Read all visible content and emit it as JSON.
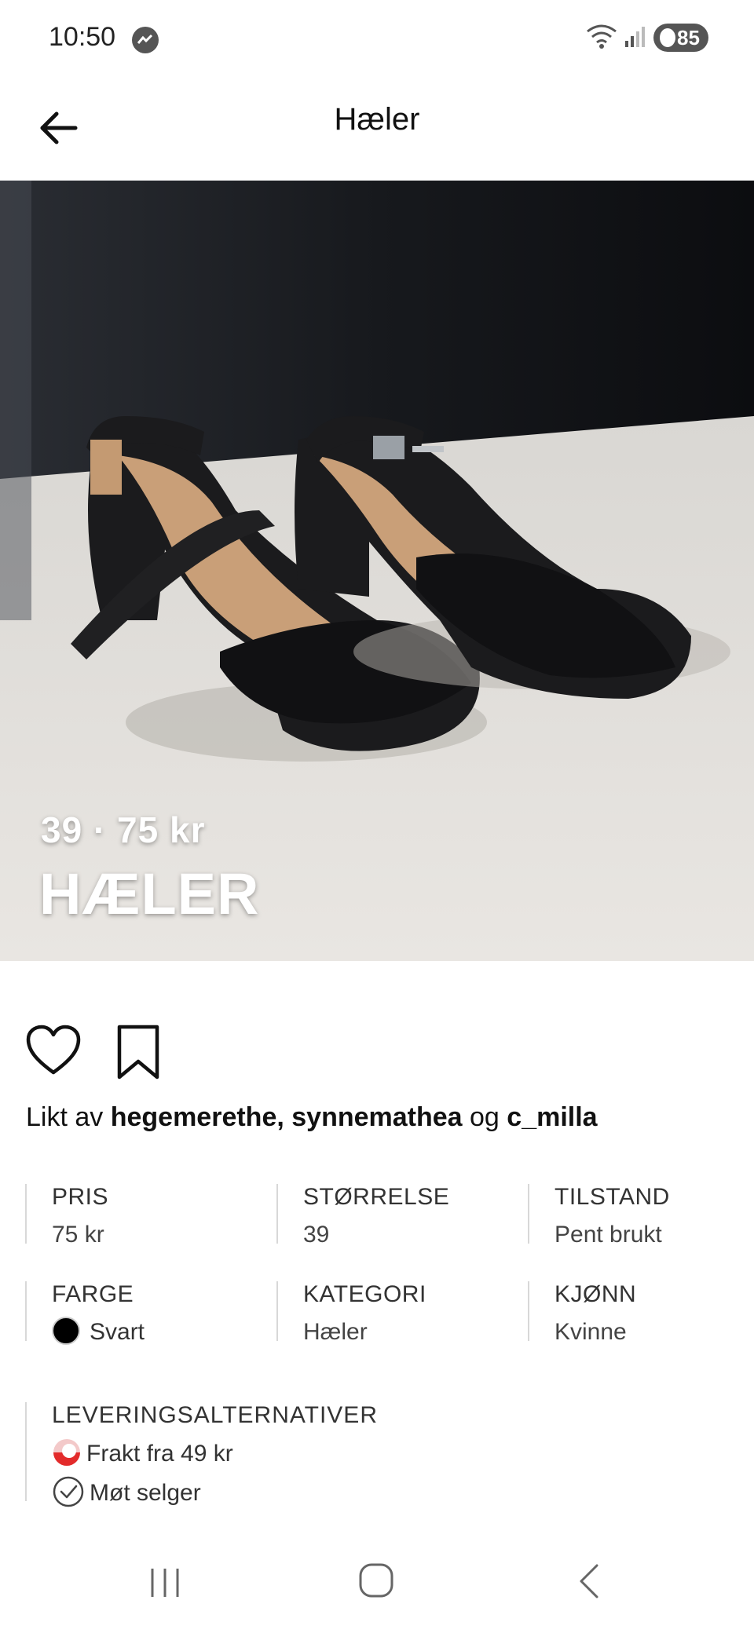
{
  "status_bar": {
    "time": "10:50",
    "battery": "85",
    "icons": [
      "messenger-icon",
      "wifi-icon",
      "signal-icon",
      "battery-icon"
    ]
  },
  "header": {
    "title": "Hæler",
    "back_icon": "arrow-left-icon"
  },
  "photo": {
    "overlay_price": "39 · 75 kr",
    "overlay_title": "HÆLER"
  },
  "actions": {
    "like_icon": "heart-icon",
    "save_icon": "bookmark-icon"
  },
  "liked_by": {
    "prefix": "Likt av",
    "users": "hegemerethe, synnemathea",
    "joiner": "og",
    "last_user": "c_milla"
  },
  "details": [
    {
      "label": "PRIS",
      "value": "75 kr"
    },
    {
      "label": "STØRRELSE",
      "value": "39"
    },
    {
      "label": "TILSTAND",
      "value": "Pent brukt"
    },
    {
      "label": "FARGE",
      "value": "Svart",
      "swatch": "#000000"
    },
    {
      "label": "KATEGORI",
      "value": "Hæler"
    },
    {
      "label": "KJØNN",
      "value": "Kvinne"
    }
  ],
  "delivery": {
    "label": "LEVERINGSALTERNATIVER",
    "options": [
      {
        "text": "Frakt fra 49 kr",
        "icon": "shipping-icon"
      },
      {
        "text": "Møt selger",
        "icon": "check-circle-icon"
      }
    ]
  },
  "nav_bar": {
    "icons": [
      "recent-apps-icon",
      "home-icon",
      "back-icon"
    ]
  },
  "colors": {
    "accent_shipping": "#e32b2b",
    "text": "#111111",
    "divider": "#d8d8d8"
  }
}
